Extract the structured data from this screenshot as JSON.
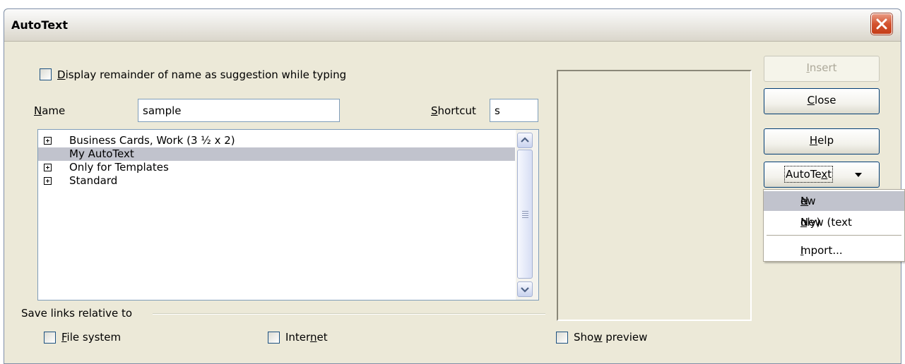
{
  "window": {
    "title": "AutoText"
  },
  "options": {
    "display_remainder": {
      "label_u": "D",
      "label_rest": "isplay remainder of name as suggestion while typing",
      "checked": false
    }
  },
  "name_field": {
    "label_u": "N",
    "label_rest": "ame",
    "value": "sample"
  },
  "shortcut_field": {
    "label_u": "S",
    "label_rest": "hortcut",
    "value": "s"
  },
  "tree": {
    "items": [
      {
        "label": "Business Cards, Work (3 ½ x 2)",
        "expandable": true,
        "selected": false
      },
      {
        "label": "My AutoText",
        "expandable": false,
        "selected": true
      },
      {
        "label": "Only for Templates",
        "expandable": true,
        "selected": false
      },
      {
        "label": "Standard",
        "expandable": true,
        "selected": false
      }
    ]
  },
  "save_links": {
    "title": "Save links relative to",
    "file_system": {
      "label_u": "F",
      "label_rest": "ile system",
      "checked": false
    },
    "internet": {
      "label_pre": "Inter",
      "label_u": "n",
      "label_rest": "et",
      "checked": false
    }
  },
  "show_preview": {
    "label_pre": "Sho",
    "label_u": "w",
    "label_rest": " preview",
    "checked": false
  },
  "buttons": {
    "insert": {
      "label_u": "I",
      "label_rest": "nsert",
      "enabled": false
    },
    "close": {
      "label_u": "C",
      "label_rest": "lose"
    },
    "help": {
      "label_u": "H",
      "label_rest": "elp"
    },
    "autotext": {
      "label_pre": "AutoTe",
      "label_u": "x",
      "label_rest": "t"
    }
  },
  "autotext_menu": {
    "new": {
      "label_u": "N",
      "label_rest": "ew"
    },
    "new_text_only": {
      "label_pre": "New (text ",
      "label_u": "o",
      "label_rest": "nly)"
    },
    "import": {
      "label_u": "I",
      "label_rest": "mport..."
    }
  }
}
